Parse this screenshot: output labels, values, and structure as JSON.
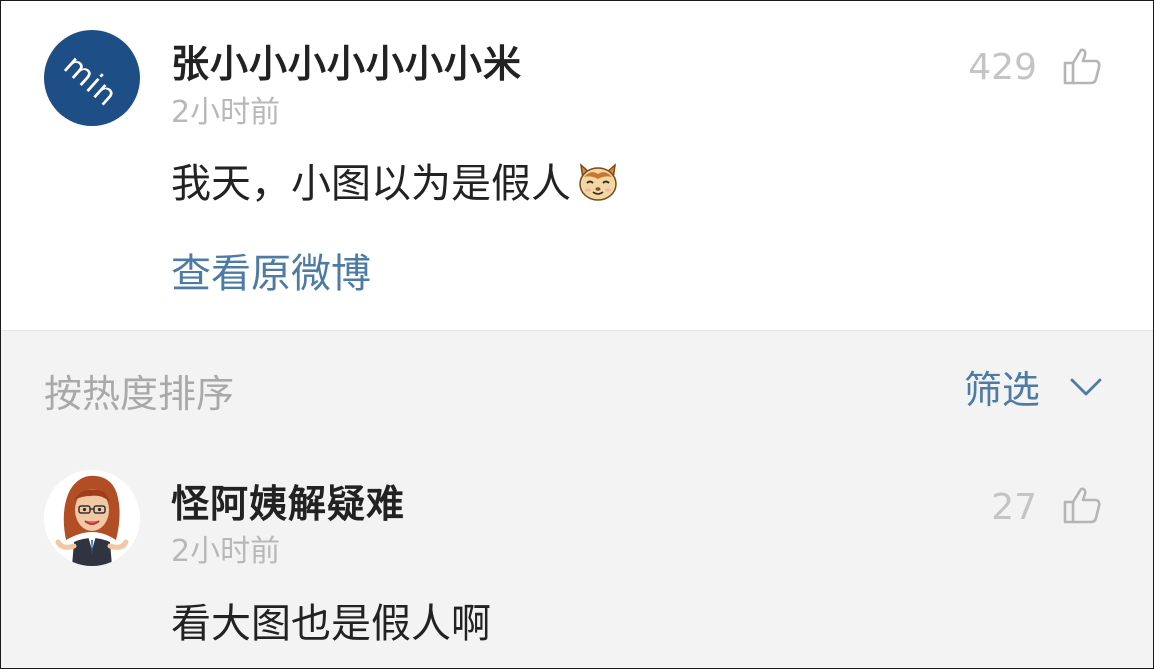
{
  "comments": [
    {
      "avatar_text": "min",
      "username": "张小小小小小小小米",
      "time": "2小时前",
      "text": "我天，小图以为是假人",
      "emoji": "cat-face-emoji",
      "likes": "429",
      "link": "查看原微博"
    },
    {
      "avatar": "cartoon-woman-avatar",
      "username": "怪阿姨解疑难",
      "time": "2小时前",
      "text": "看大图也是假人啊",
      "likes": "27"
    }
  ],
  "sort_bar": {
    "label": "按热度排序",
    "filter_label": "筛选",
    "filter_icon": "chevron-down-icon"
  },
  "colors": {
    "link": "#4e7ba4",
    "muted": "#b8b8b8",
    "text": "#222222",
    "avatar_bg": "#1e4e86",
    "section_bg": "#f3f3f3"
  }
}
